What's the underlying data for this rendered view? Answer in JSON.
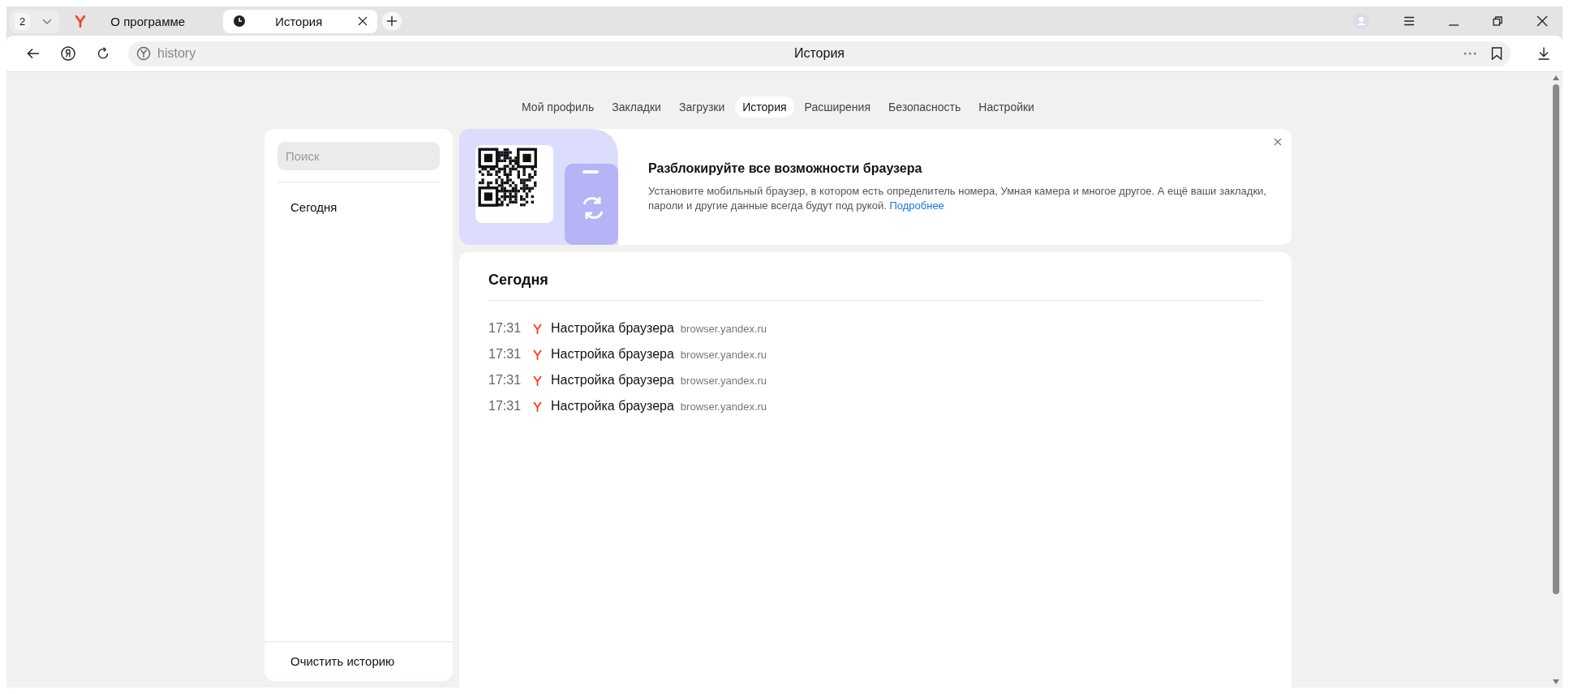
{
  "tab_strip": {
    "tab_count": "2",
    "tabs": [
      {
        "title": "О программе",
        "kind": "site",
        "selected": false
      },
      {
        "title": "История",
        "kind": "history",
        "selected": true
      }
    ]
  },
  "address_bar": {
    "url": "history",
    "page_title": "История"
  },
  "nav": [
    {
      "label": "Мой профиль",
      "selected": false
    },
    {
      "label": "Закладки",
      "selected": false
    },
    {
      "label": "Загрузки",
      "selected": false
    },
    {
      "label": "История",
      "selected": true
    },
    {
      "label": "Расширения",
      "selected": false
    },
    {
      "label": "Безопасность",
      "selected": false
    },
    {
      "label": "Настройки",
      "selected": false
    }
  ],
  "sidebar": {
    "search": {
      "placeholder": "Поиск"
    },
    "items": [
      {
        "label": "Сегодня"
      }
    ],
    "clear_button": "Очистить историю"
  },
  "banner": {
    "title": "Разблокируйте все возможности браузера",
    "text": "Установите мобильный браузер, в котором есть определитель номера, Умная камера и многое другое. А ещё ваши закладки, пароли и другие данные всегда будут под рукой.",
    "link": "Подробнее"
  },
  "history": {
    "groups": [
      {
        "heading": "Сегодня",
        "entries": [
          {
            "time": "17:31",
            "title": "Настройка браузера",
            "domain": "browser.yandex.ru"
          },
          {
            "time": "17:31",
            "title": "Настройка браузера",
            "domain": "browser.yandex.ru"
          },
          {
            "time": "17:31",
            "title": "Настройка браузера",
            "domain": "browser.yandex.ru"
          },
          {
            "time": "17:31",
            "title": "Настройка браузера",
            "domain": "browser.yandex.ru"
          }
        ]
      }
    ]
  }
}
